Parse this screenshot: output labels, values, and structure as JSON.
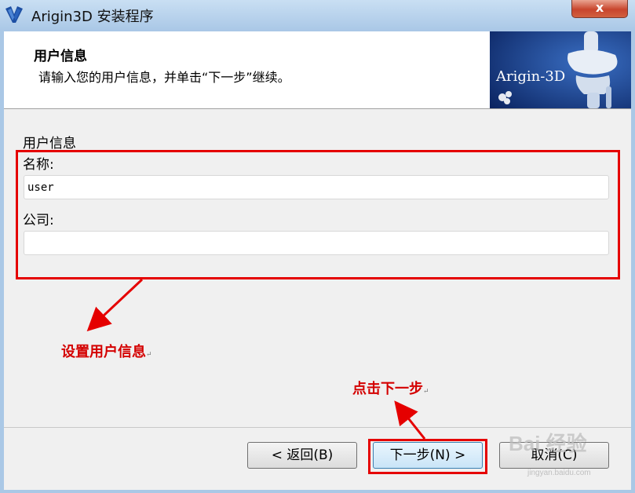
{
  "window": {
    "title": "Arigin3D 安装程序",
    "close_glyph": "x"
  },
  "header": {
    "title": "用户信息",
    "subtitle": "请输入您的用户信息，并单击“下一步”继续。",
    "banner_text": "Arigin-3D"
  },
  "form": {
    "section_label": "用户信息",
    "name_label": "名称:",
    "name_value": "user",
    "company_label": "公司:",
    "company_value": ""
  },
  "annotations": {
    "set_user_info": "设置用户信息",
    "click_next": "点击下一步",
    "return_mark": "↵"
  },
  "buttons": {
    "back": "< 返回(B)",
    "next": "下一步(N) >",
    "cancel": "取消(C)"
  },
  "watermark": {
    "brand": "Bai 经验",
    "sub": "jingyan.baidu.com"
  },
  "colors": {
    "annotation": "#d40000",
    "highlight_box": "#e50000",
    "title_bar": "#b7d3ee"
  },
  "icons": {
    "app": "arigin3d-app-icon",
    "close": "close-icon",
    "banner": "knee-bone-banner-image"
  }
}
